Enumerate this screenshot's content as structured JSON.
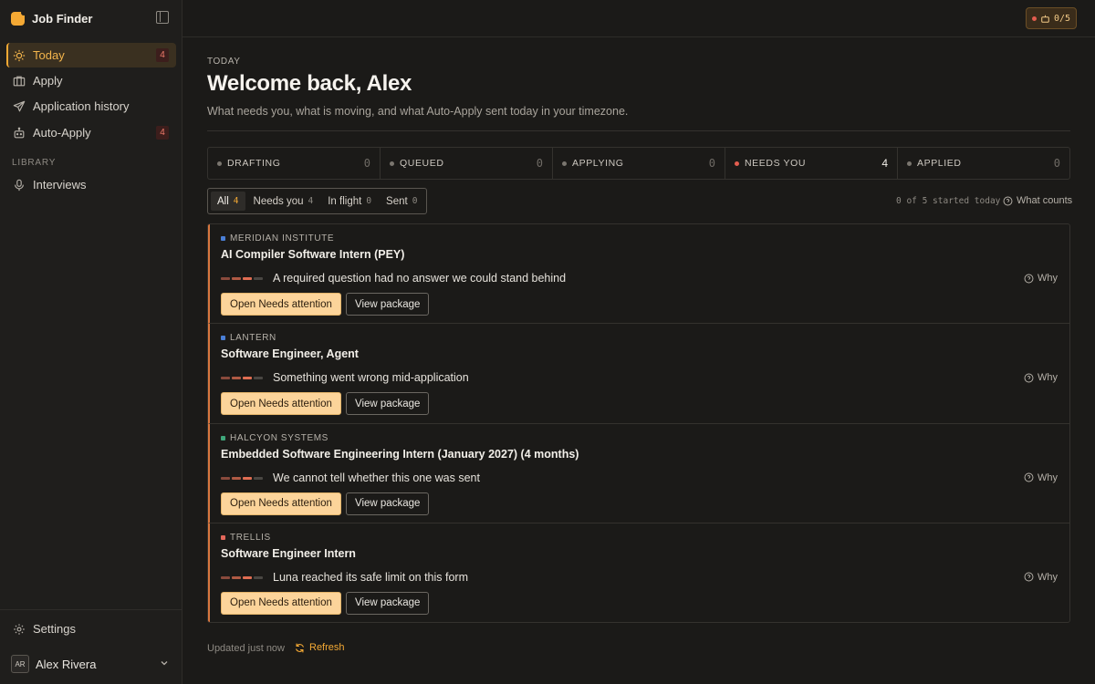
{
  "app": {
    "title": "Job Finder"
  },
  "sidebar": {
    "items": [
      {
        "label": "Today",
        "icon": "sun-icon",
        "badge": "4",
        "active": true
      },
      {
        "label": "Apply",
        "icon": "briefcase-icon"
      },
      {
        "label": "Application history",
        "icon": "send-icon"
      },
      {
        "label": "Auto-Apply",
        "icon": "robot-icon",
        "badge": "4"
      }
    ],
    "section_label": "LIBRARY",
    "library_items": [
      {
        "label": "Interviews",
        "icon": "microphone-icon"
      }
    ],
    "settings_label": "Settings",
    "user": {
      "initials": "AR",
      "name": "Alex Rivera"
    }
  },
  "topbar": {
    "quota": "0/5"
  },
  "main": {
    "eyebrow": "TODAY",
    "title": "Welcome back, Alex",
    "subtitle": "What needs you, what is moving, and what Auto-Apply sent today in your timezone.",
    "stats": [
      {
        "label": "DRAFTING",
        "value": "0"
      },
      {
        "label": "QUEUED",
        "value": "0"
      },
      {
        "label": "APPLYING",
        "value": "0"
      },
      {
        "label": "NEEDS YOU",
        "value": "4"
      },
      {
        "label": "APPLIED",
        "value": "0"
      }
    ],
    "filters": [
      {
        "label": "All",
        "count": "4"
      },
      {
        "label": "Needs you",
        "count": "4"
      },
      {
        "label": "In flight",
        "count": "0"
      },
      {
        "label": "Sent",
        "count": "0"
      }
    ],
    "started_today": "0 of 5 started today",
    "what_counts": "What counts",
    "cards": [
      {
        "company": "MERIDIAN INSTITUTE",
        "company_color": "#4a7fd6",
        "title": "AI Compiler Software Intern (PEY)",
        "status": "A required question had no answer we could stand behind"
      },
      {
        "company": "LANTERN",
        "company_color": "#4a7fd6",
        "title": "Software Engineer, Agent",
        "status": "Something went wrong mid-application"
      },
      {
        "company": "HALCYON SYSTEMS",
        "company_color": "#3fa67a",
        "title": "Embedded Software Engineering Intern (January 2027) (4 months)",
        "status": "We cannot tell whether this one was sent"
      },
      {
        "company": "TRELLIS",
        "company_color": "#e3675a",
        "title": "Software Engineer Intern",
        "status": "Luna reached its safe limit on this form"
      }
    ],
    "card_actions": {
      "primary": "Open Needs attention",
      "secondary": "View package",
      "why": "Why"
    },
    "footer": {
      "updated": "Updated just now",
      "refresh": "Refresh"
    }
  },
  "colors": {
    "accent": "#f4a934",
    "danger": "#e35d4f",
    "background": "#1b1a18"
  }
}
